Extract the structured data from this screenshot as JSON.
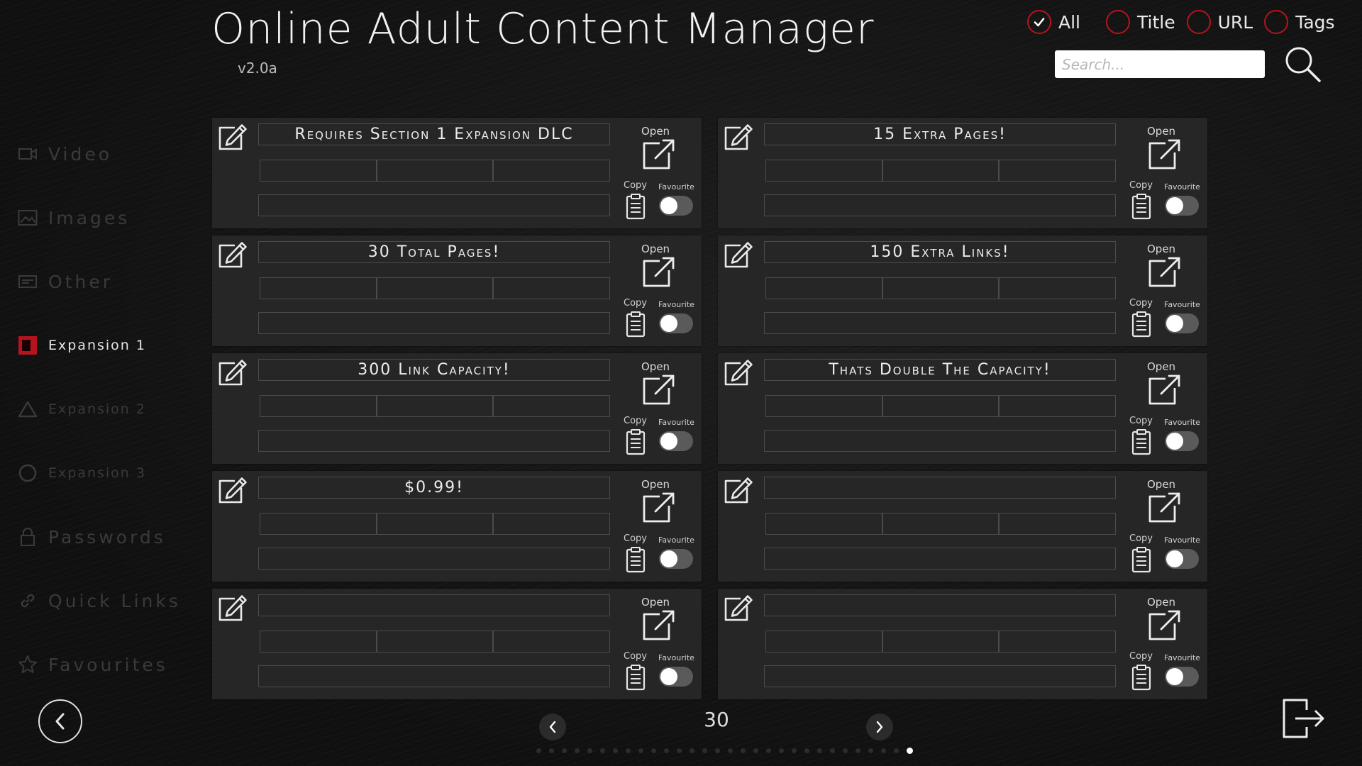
{
  "header": {
    "title": "Online Adult Content Manager",
    "version": "v2.0a"
  },
  "filters": {
    "options": [
      {
        "label": "All",
        "checked": true
      },
      {
        "label": "Title",
        "checked": false
      },
      {
        "label": "URL",
        "checked": false
      },
      {
        "label": "Tags",
        "checked": false
      }
    ],
    "search_placeholder": "Search..."
  },
  "sidebar": {
    "items": [
      {
        "label": "Video",
        "icon": "video-icon",
        "active": false
      },
      {
        "label": "Images",
        "icon": "image-icon",
        "active": false
      },
      {
        "label": "Other",
        "icon": "other-icon",
        "active": false
      },
      {
        "label": "Expansion 1",
        "icon": "expansion-1-icon",
        "active": true
      },
      {
        "label": "Expansion 2",
        "icon": "triangle-icon",
        "active": false
      },
      {
        "label": "Expansion 3",
        "icon": "circle-icon",
        "active": false
      },
      {
        "label": "Passwords",
        "icon": "lock-icon",
        "active": false
      },
      {
        "label": "Quick Links",
        "icon": "link-icon",
        "active": false
      },
      {
        "label": "Favourites",
        "icon": "star-icon",
        "active": false
      }
    ]
  },
  "card_labels": {
    "open": "Open",
    "copy": "Copy",
    "favourite": "Favourite"
  },
  "cards": [
    {
      "title": "Requires Section 1 Expansion DLC",
      "favourite": false
    },
    {
      "title": "15 Extra Pages!",
      "favourite": false
    },
    {
      "title": "30 Total Pages!",
      "favourite": false
    },
    {
      "title": "150 Extra Links!",
      "favourite": false
    },
    {
      "title": "300 Link Capacity!",
      "favourite": false
    },
    {
      "title": "Thats Double The Capacity!",
      "favourite": false
    },
    {
      "title": "$0.99!",
      "favourite": false
    },
    {
      "title": "",
      "favourite": false
    },
    {
      "title": "",
      "favourite": false
    },
    {
      "title": "",
      "favourite": false
    }
  ],
  "pagination": {
    "current_page": "30",
    "total_dots": 30,
    "active_dot": 30
  },
  "colors": {
    "accent": "#b5141e",
    "background": "#121212",
    "card": "#262626"
  }
}
